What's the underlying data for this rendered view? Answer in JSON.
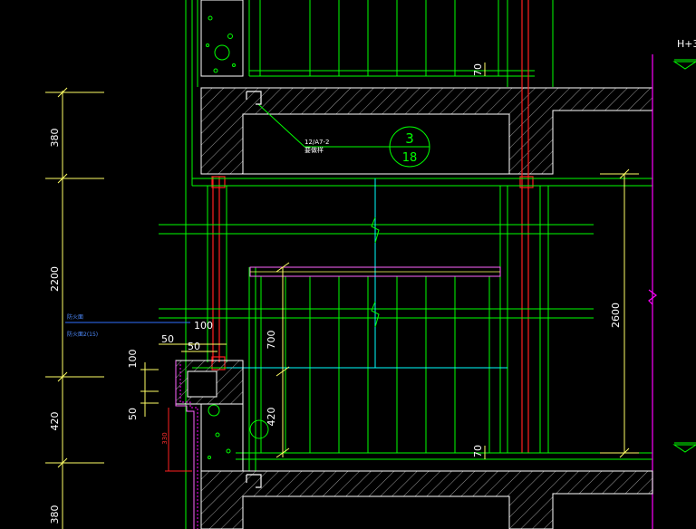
{
  "drawing": {
    "background": "#000000",
    "colors": {
      "wall": "#ffffff",
      "glazing": "#00ff00",
      "frame": "#ffff66",
      "cyan": "#00ffff",
      "magenta": "#ff00ff",
      "red": "#ff2020",
      "blue": "#3070ff",
      "hatch": "#b0b0b0"
    }
  },
  "left_dims": {
    "d1": "380",
    "d2": "2200",
    "d3": "420",
    "d4": "380"
  },
  "detail_dims": {
    "d100_h": "100",
    "d50_h": "50",
    "d50_h2": "50",
    "d100_v": "100",
    "d50_v": "50",
    "d330_v": "330"
  },
  "window_dims": {
    "d700": "700",
    "d420": "420",
    "d70_top": "70",
    "d70_bot": "70",
    "d2600": "2600"
  },
  "level_mark": "H+3",
  "callout": {
    "top": "3",
    "bottom": "18",
    "leader_line1": "12/A7-2",
    "leader_line2": "要做样"
  },
  "blue_notes": {
    "line1": "防火面",
    "line2": "防火面2(15)"
  }
}
